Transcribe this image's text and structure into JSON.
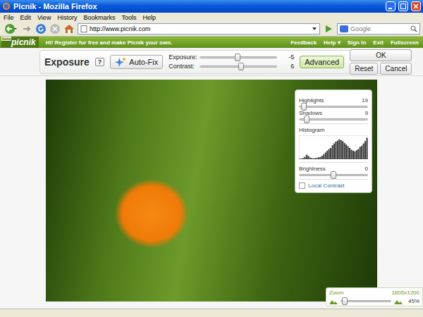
{
  "window": {
    "title": "Picnik - Mozilla Firefox"
  },
  "menu": [
    "File",
    "Edit",
    "View",
    "History",
    "Bookmarks",
    "Tools",
    "Help"
  ],
  "navigation": {
    "url": "http://www.picnik.com",
    "search_placeholder": "Google"
  },
  "header": {
    "logo": "picnik",
    "badge": "beta",
    "message": "Hi! Register for free and make Picnik your own.",
    "links": [
      "Feedback",
      "Help ▾",
      "Sign In",
      "Exit",
      "Fullscreen"
    ]
  },
  "tool": {
    "title": "Exposure",
    "help": "?",
    "autofix": "Auto-Fix",
    "sliders": [
      {
        "label": "Exposure:",
        "level": 0.49,
        "reading": "-5"
      },
      {
        "label": "Contrast:",
        "level": 0.53,
        "reading": "6"
      }
    ],
    "advanced": {
      "label": "Advanced",
      "selected": true
    },
    "buttons": {
      "ok": "OK",
      "reset": "Reset",
      "cancel": "Cancel"
    }
  },
  "advanced_panel": {
    "sliders": [
      {
        "label": "Highlights",
        "level": 0.06,
        "reading": "19"
      },
      {
        "label": "Shadows",
        "level": 0.1,
        "reading": "9"
      }
    ],
    "histogram": {
      "label": "Histogram",
      "values": [
        0.02,
        0.03,
        0.05,
        0.1,
        0.2,
        0.15,
        0.08,
        0.05,
        0.04,
        0.05,
        0.06,
        0.08,
        0.1,
        0.15,
        0.22,
        0.3,
        0.38,
        0.45,
        0.5,
        0.62,
        0.7,
        0.78,
        0.82,
        0.88,
        0.85,
        0.8,
        0.72,
        0.65,
        0.58,
        0.5,
        0.42,
        0.38,
        0.35,
        0.4,
        0.45,
        0.55,
        0.6,
        0.7,
        0.8,
        0.95
      ]
    },
    "brightness": {
      "label": "Brightness",
      "level": 0.5,
      "reading": "0"
    },
    "local_contrast": {
      "label": "Local Contrast",
      "checked": false
    }
  },
  "zoom": {
    "label": "Zoom",
    "size": "1805x1200",
    "level": 0.07,
    "reading": "45%"
  }
}
